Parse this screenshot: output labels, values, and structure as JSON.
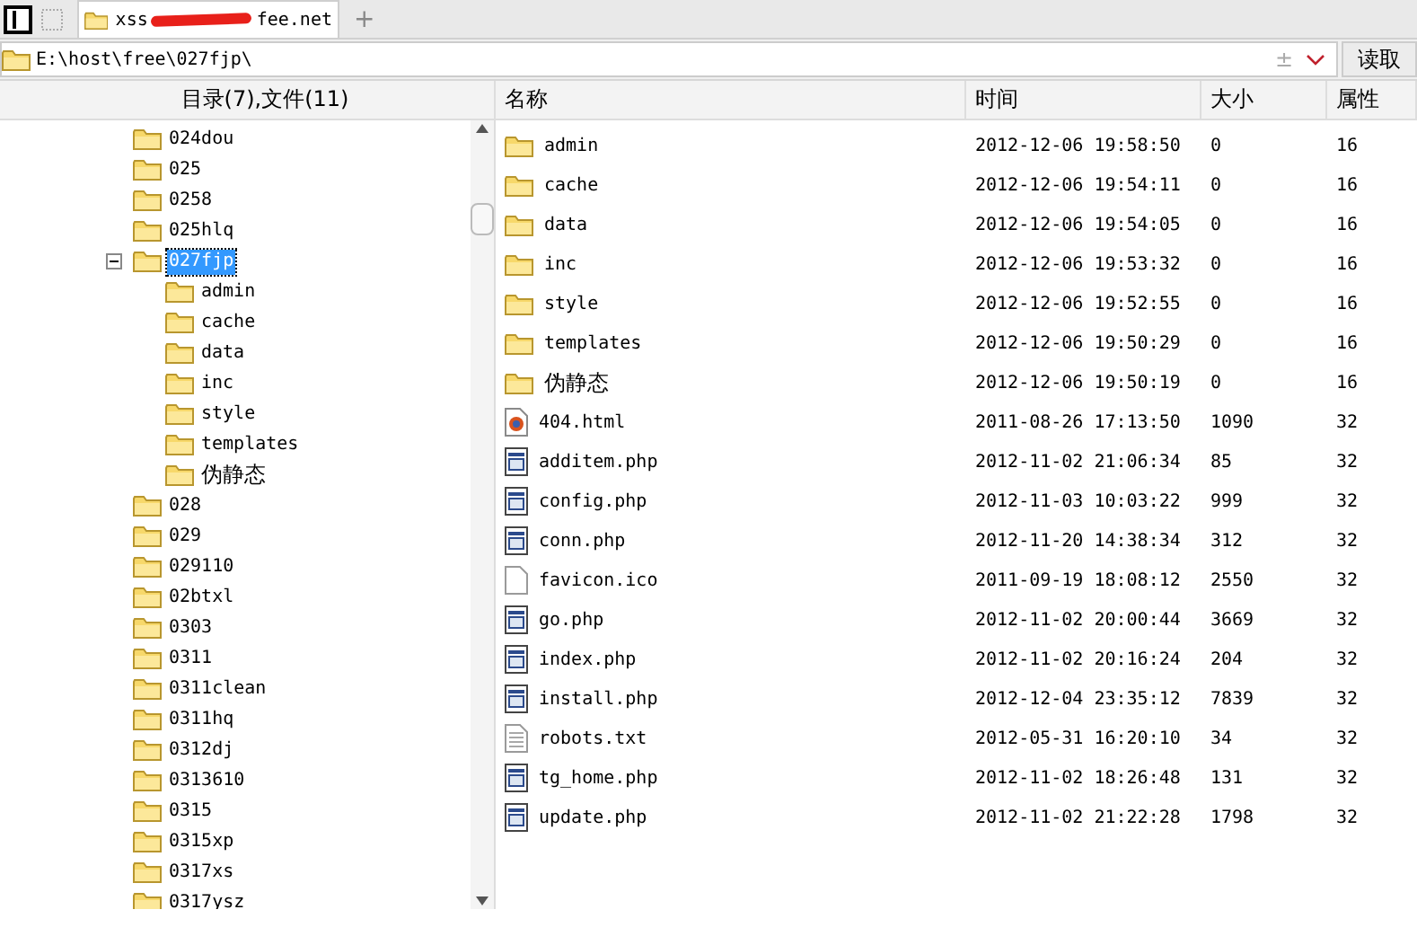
{
  "tabs": [
    {
      "title_start": "xss",
      "title_end": "fee.net",
      "redacted": true,
      "selected": true
    }
  ],
  "new_tab": "+",
  "address": {
    "value": "E:\\host\\free\\027fjp\\",
    "button": "读取",
    "plusminus": "±"
  },
  "tree": {
    "header": "目录(7),文件(11)",
    "items": [
      {
        "label": "024dou",
        "selected": false
      },
      {
        "label": "025",
        "selected": false
      },
      {
        "label": "0258",
        "selected": false
      },
      {
        "label": "025hlq",
        "selected": false
      },
      {
        "label": "027fjp",
        "expanded": true,
        "selected": true,
        "children": [
          {
            "label": "admin",
            "selected": false
          },
          {
            "label": "cache",
            "selected": false
          },
          {
            "label": "data",
            "selected": false
          },
          {
            "label": "inc",
            "selected": false
          },
          {
            "label": "style",
            "selected": false
          },
          {
            "label": "templates",
            "selected": false
          },
          {
            "label": "伪静态",
            "selected": false
          }
        ]
      },
      {
        "label": "028",
        "selected": false
      },
      {
        "label": "029",
        "selected": false
      },
      {
        "label": "029110",
        "selected": false
      },
      {
        "label": "02btxl",
        "selected": false
      },
      {
        "label": "0303",
        "selected": false
      },
      {
        "label": "0311",
        "selected": false
      },
      {
        "label": "0311clean",
        "selected": false
      },
      {
        "label": "0311hq",
        "selected": false
      },
      {
        "label": "0312dj",
        "selected": false
      },
      {
        "label": "0313610",
        "selected": false
      },
      {
        "label": "0315",
        "selected": false
      },
      {
        "label": "0315xp",
        "selected": false
      },
      {
        "label": "0317xs",
        "selected": false
      },
      {
        "label": "0317ysz",
        "selected": false
      }
    ]
  },
  "table": {
    "columns": [
      "名称",
      "时间",
      "大小",
      "属性"
    ],
    "rows": [
      {
        "kind": "folder",
        "name": "admin",
        "time": "2012-12-06 19:58:50",
        "size": "0",
        "attr": "16"
      },
      {
        "kind": "folder",
        "name": "cache",
        "time": "2012-12-06 19:54:11",
        "size": "0",
        "attr": "16"
      },
      {
        "kind": "folder",
        "name": "data",
        "time": "2012-12-06 19:54:05",
        "size": "0",
        "attr": "16"
      },
      {
        "kind": "folder",
        "name": "inc",
        "time": "2012-12-06 19:53:32",
        "size": "0",
        "attr": "16"
      },
      {
        "kind": "folder",
        "name": "style",
        "time": "2012-12-06 19:52:55",
        "size": "0",
        "attr": "16"
      },
      {
        "kind": "folder",
        "name": "templates",
        "time": "2012-12-06 19:50:29",
        "size": "0",
        "attr": "16"
      },
      {
        "kind": "folder",
        "name": "伪静态",
        "time": "2012-12-06 19:50:19",
        "size": "0",
        "attr": "16"
      },
      {
        "kind": "html",
        "name": "404.html",
        "time": "2011-08-26 17:13:50",
        "size": "1090",
        "attr": "32"
      },
      {
        "kind": "php",
        "name": "additem.php",
        "time": "2012-11-02 21:06:34",
        "size": "85",
        "attr": "32"
      },
      {
        "kind": "php",
        "name": "config.php",
        "time": "2012-11-03 10:03:22",
        "size": "999",
        "attr": "32"
      },
      {
        "kind": "php",
        "name": "conn.php",
        "time": "2012-11-20 14:38:34",
        "size": "312",
        "attr": "32"
      },
      {
        "kind": "blank",
        "name": "favicon.ico",
        "time": "2011-09-19 18:08:12",
        "size": "2550",
        "attr": "32"
      },
      {
        "kind": "php",
        "name": "go.php",
        "time": "2012-11-02 20:00:44",
        "size": "3669",
        "attr": "32"
      },
      {
        "kind": "php",
        "name": "index.php",
        "time": "2012-11-02 20:16:24",
        "size": "204",
        "attr": "32"
      },
      {
        "kind": "php",
        "name": "install.php",
        "time": "2012-12-04 23:35:12",
        "size": "7839",
        "attr": "32"
      },
      {
        "kind": "text",
        "name": "robots.txt",
        "time": "2012-05-31 16:20:10",
        "size": "34",
        "attr": "32"
      },
      {
        "kind": "php",
        "name": "tg_home.php",
        "time": "2012-11-02 18:26:48",
        "size": "131",
        "attr": "32"
      },
      {
        "kind": "php",
        "name": "update.php",
        "time": "2012-11-02 21:22:28",
        "size": "1798",
        "attr": "32"
      }
    ]
  }
}
